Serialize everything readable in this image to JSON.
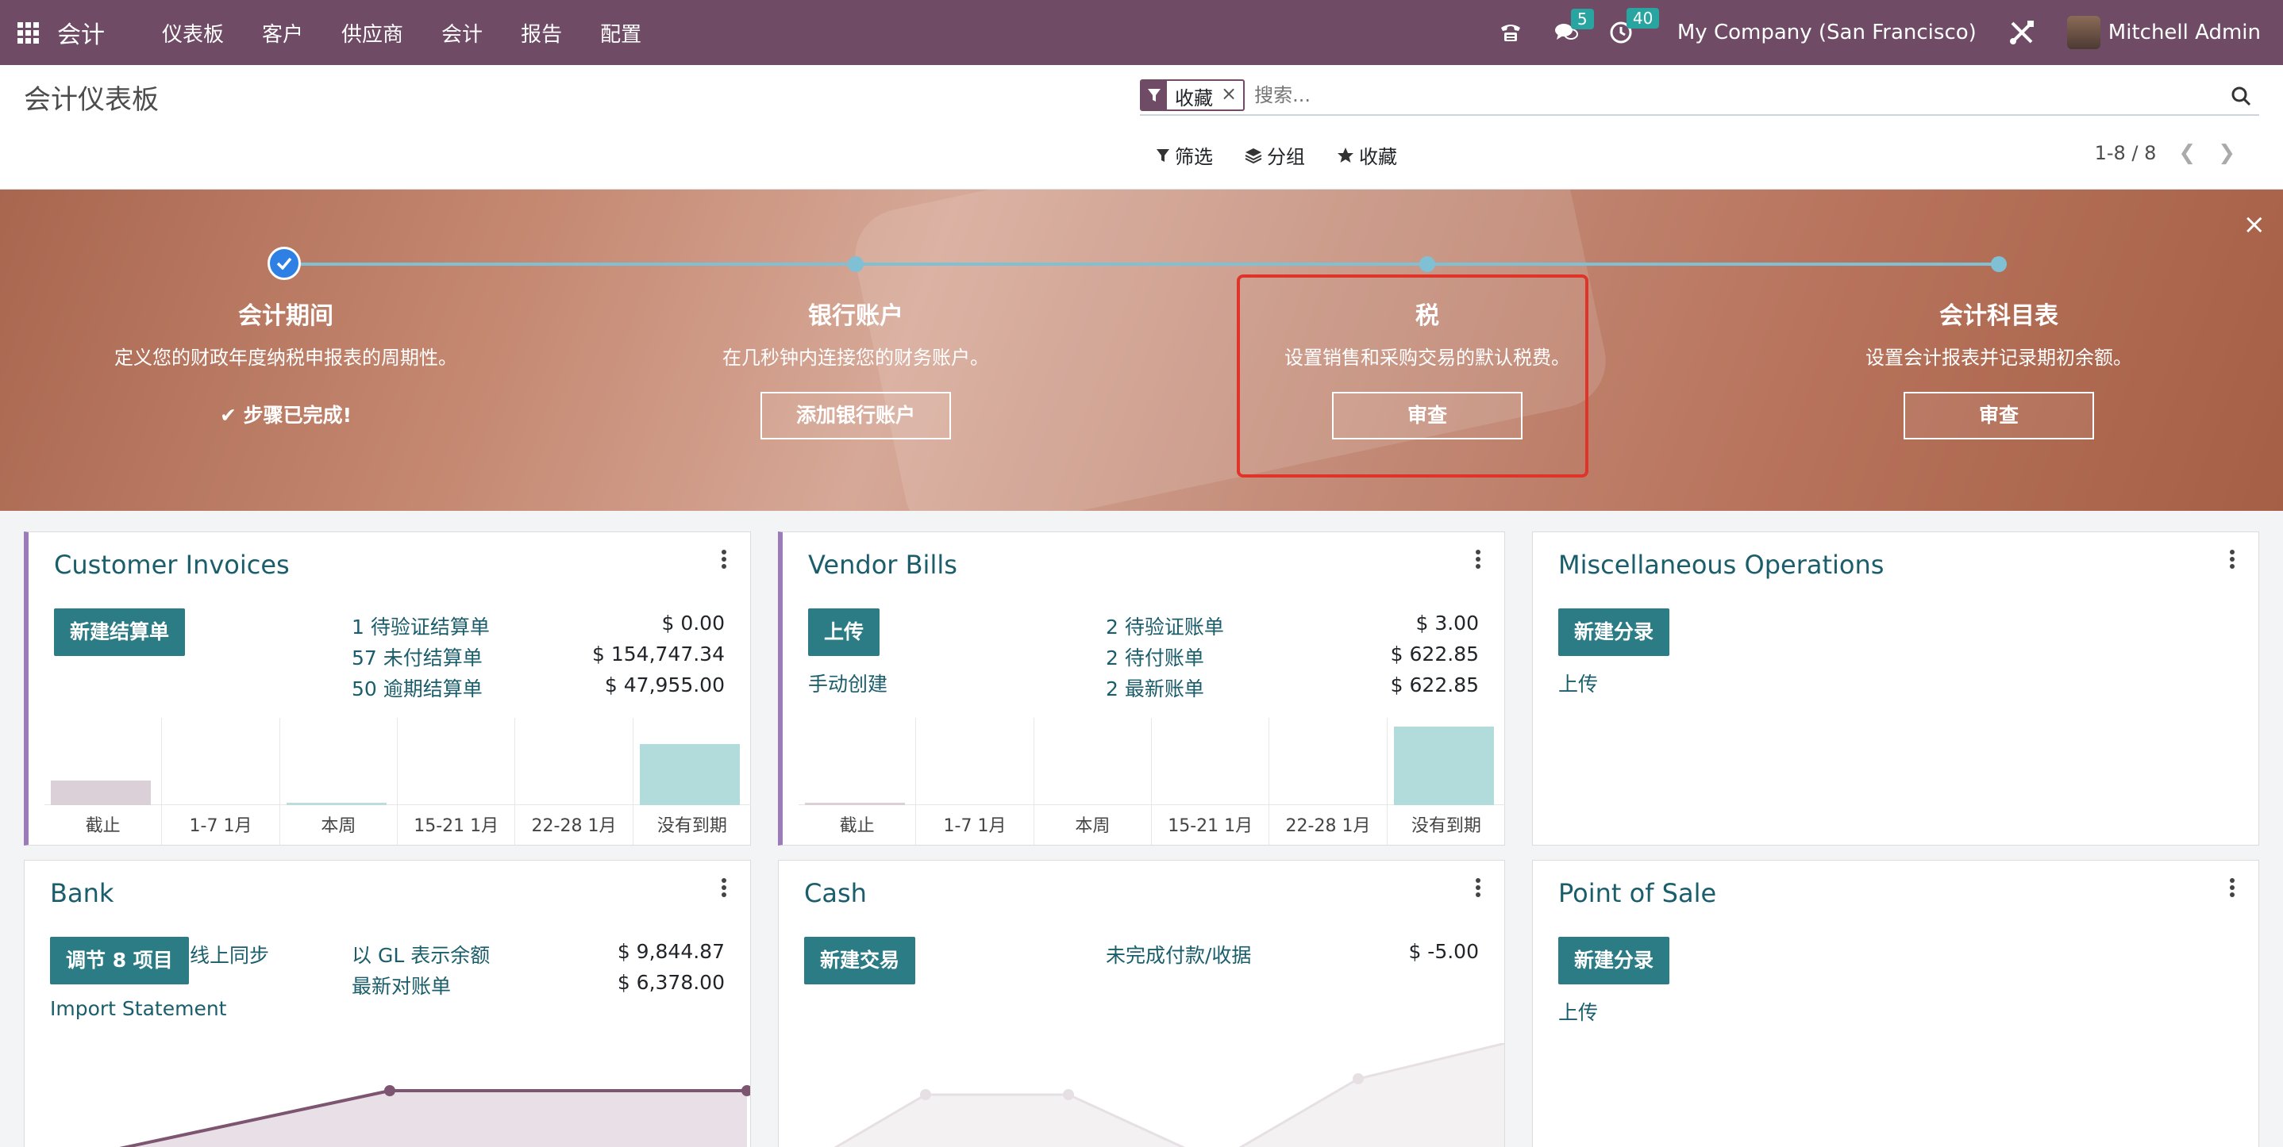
{
  "topnav": {
    "app_name": "会计",
    "menu": [
      "仪表板",
      "客户",
      "供应商",
      "会计",
      "报告",
      "配置"
    ],
    "messages_count": "5",
    "activities_count": "40",
    "company": "My Company (San Francisco)",
    "user": "Mitchell Admin"
  },
  "control": {
    "title": "会计仪表板",
    "facet_label": "收藏",
    "facet_remove": "×",
    "search_placeholder": "搜索...",
    "filters_label": "筛选",
    "groupby_label": "分组",
    "favorites_label": "收藏",
    "pager": "1-8 / 8"
  },
  "banner": {
    "close": "×",
    "steps": [
      {
        "title": "会计期间",
        "desc": "定义您的财政年度纳税申报表的周期性。",
        "done_text": "步骤已完成!"
      },
      {
        "title": "银行账户",
        "desc": "在几秒钟内连接您的财务账户。",
        "button": "添加银行账户"
      },
      {
        "title": "税",
        "desc": "设置销售和采购交易的默认税费。",
        "button": "审查"
      },
      {
        "title": "会计科目表",
        "desc": "设置会计报表并记录期初余额。",
        "button": "审查"
      }
    ]
  },
  "cards": {
    "customer_invoices": {
      "title": "Customer Invoices",
      "button": "新建结算单",
      "stats": [
        {
          "label": "1 待验证结算单",
          "value": "$ 0.00"
        },
        {
          "label": "57 未付结算单",
          "value": "$ 154,747.34"
        },
        {
          "label": "50 逾期结算单",
          "value": "$ 47,955.00"
        }
      ]
    },
    "vendor_bills": {
      "title": "Vendor Bills",
      "button": "上传",
      "secondary_link": "手动创建",
      "stats": [
        {
          "label": "2 待验证账单",
          "value": "$ 3.00"
        },
        {
          "label": "2 待付账单",
          "value": "$ 622.85"
        },
        {
          "label": "2 最新账单",
          "value": "$ 622.85"
        }
      ]
    },
    "misc": {
      "title": "Miscellaneous Operations",
      "button": "新建分录",
      "secondary_link": "上传"
    },
    "bank": {
      "title": "Bank",
      "button": "调节 8 项目",
      "online_sync": "线上同步",
      "secondary_link": "Import Statement",
      "stats": [
        {
          "label": "以 GL 表示余额",
          "value": "$ 9,844.87"
        },
        {
          "label": "最新对账单",
          "value": "$ 6,378.00"
        }
      ]
    },
    "cash": {
      "title": "Cash",
      "button": "新建交易",
      "stats": [
        {
          "label": "未完成付款/收据",
          "value": "$ -5.00"
        }
      ]
    },
    "pos": {
      "title": "Point of Sale",
      "button": "新建分录",
      "secondary_link": "上传"
    }
  },
  "chart_data": [
    {
      "type": "bar",
      "name": "Customer Invoices",
      "categories": [
        "截止",
        "1-7 1月",
        "本周",
        "15-21 1月",
        "22-28 1月",
        "没有到期"
      ],
      "values": [
        0.28,
        0,
        0.03,
        0,
        0,
        0.7
      ],
      "colors": [
        "#dcd0d8",
        "#b9dedd",
        "#b9dedd",
        "#b9dedd",
        "#b9dedd",
        "#b2dcdb"
      ]
    },
    {
      "type": "bar",
      "name": "Vendor Bills",
      "categories": [
        "截止",
        "1-7 1月",
        "本周",
        "15-21 1月",
        "22-28 1月",
        "没有到期"
      ],
      "values": [
        0.03,
        0,
        0,
        0,
        0,
        0.9
      ],
      "colors": [
        "#dcd0d8",
        "#b9dedd",
        "#b9dedd",
        "#b9dedd",
        "#b9dedd",
        "#b2dcdb"
      ]
    }
  ],
  "colors": {
    "nav": "#6f4b66",
    "teal": "#2c7c85",
    "link": "#1b5e6b",
    "highlight": "#e0342a"
  }
}
